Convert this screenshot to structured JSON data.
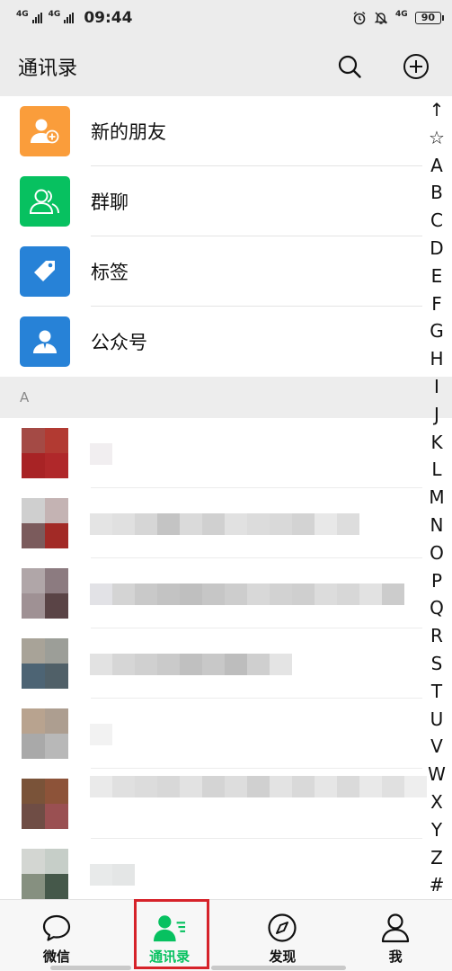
{
  "status_bar": {
    "network_1": "4G",
    "network_2": "4G",
    "time": "09:44",
    "network_3": "4G",
    "battery": "90"
  },
  "header": {
    "title": "通讯录"
  },
  "features": [
    {
      "label": "新的朋友",
      "icon": "add-friend-icon",
      "color": "#fa9d3b"
    },
    {
      "label": "群聊",
      "icon": "group-chat-icon",
      "color": "#07c160"
    },
    {
      "label": "标签",
      "icon": "tag-icon",
      "color": "#2782d7"
    },
    {
      "label": "公众号",
      "icon": "official-account-icon",
      "color": "#2782d7"
    }
  ],
  "section": {
    "letter": "A"
  },
  "index_bar": [
    "↑",
    "☆",
    "A",
    "B",
    "C",
    "D",
    "E",
    "F",
    "G",
    "H",
    "I",
    "J",
    "K",
    "L",
    "M",
    "N",
    "O",
    "P",
    "Q",
    "R",
    "S",
    "T",
    "U",
    "V",
    "W",
    "X",
    "Y",
    "Z",
    "#"
  ],
  "tabs": [
    {
      "label": "微信",
      "icon": "chat-bubble-icon",
      "active": false
    },
    {
      "label": "通讯录",
      "icon": "contacts-icon",
      "active": true
    },
    {
      "label": "发现",
      "icon": "compass-icon",
      "active": false
    },
    {
      "label": "我",
      "icon": "person-icon",
      "active": false
    }
  ],
  "colors": {
    "accent": "#07c160",
    "highlight": "#d6232a"
  }
}
